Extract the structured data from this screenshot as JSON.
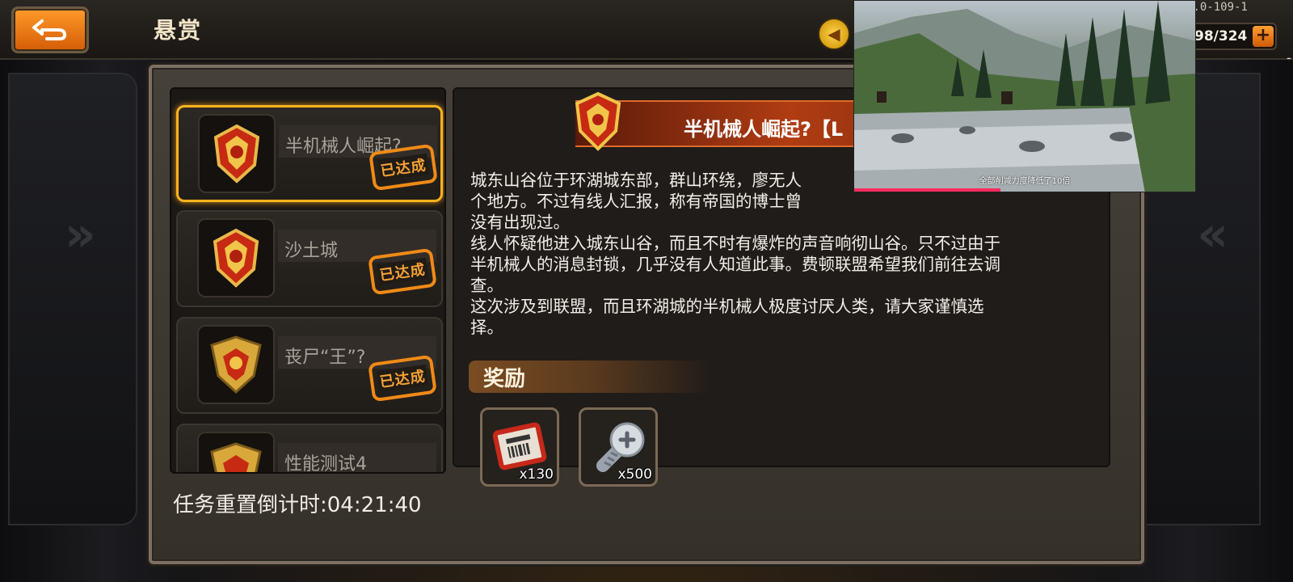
{
  "header": {
    "title": "悬赏",
    "version": "1.0-109-1",
    "energy": "98/324",
    "energy_plus": "+",
    "coin_icon": "gold-coin-icon"
  },
  "quest_list": [
    {
      "name": "半机械人崛起?",
      "status": "已达成",
      "selected": true
    },
    {
      "name": "沙土城",
      "status": "已达成",
      "selected": false
    },
    {
      "name": "丧尸“王”?",
      "status": "已达成",
      "selected": false
    },
    {
      "name": "性能测试4",
      "status": "",
      "selected": false
    }
  ],
  "timer_text": "任务重置倒计时:04:21:40",
  "detail": {
    "title": "半机械人崛起?【L",
    "description": [
      "城东山谷位于环湖城东部，群山环绕，廖无人",
      "个地方。不过有线人汇报，称有帝国的博士曾",
      "没有出现过。",
      "线人怀疑他进入城东山谷，而且不时有爆炸的声音响彻山谷。只不过由于",
      "半机械人的消息封锁，几乎没有人知道此事。费顿联盟希望我们前往去调",
      "查。",
      "这次涉及到联盟，而且环湖城的半机械人极度讨厌人类，请大家谨慎选",
      "择。"
    ],
    "reward_label": "奖励",
    "rewards": [
      {
        "icon": "ticket-icon",
        "count": "x130"
      },
      {
        "icon": "screw-icon",
        "count": "x500"
      }
    ]
  },
  "video_overlay": {
    "subtitle": "全部削减力度降低了10倍",
    "progress": 0.43
  },
  "colors": {
    "accent_orange": "#f08a16",
    "selected_border": "#ffb21c",
    "header_red": "#b03c12"
  }
}
